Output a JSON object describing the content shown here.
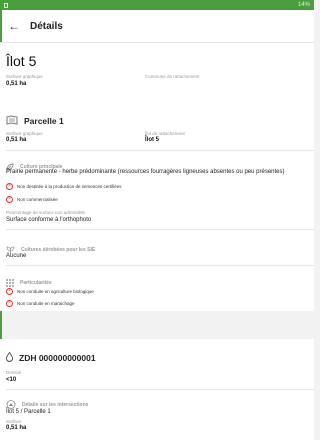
{
  "status": {
    "right": "14%"
  },
  "appbar": {
    "back_icon": "arrow-left-icon",
    "title": "Détails"
  },
  "ilot": {
    "title": "Îlot 5",
    "surface_label": "Surface graphique",
    "surface_value": "0,51 ha",
    "commune_label": "Commune de rattachement"
  },
  "parcelle": {
    "title": "Parcelle 1",
    "surface_label": "Surface graphique",
    "surface_value": "0,51 ha",
    "ilot_label": "Îlot de rattachement",
    "ilot_value": "Îlot 5",
    "culture_header": "Culture principale",
    "culture_value": "Prairie permanente - herbe prédominante (ressources fourragères ligneuses absentes ou peu présentes)",
    "flags": [
      "Non destinée à la production de semences certifiées",
      "Non commercialisée"
    ],
    "pct_label": "Pourcentage de surface non admissible",
    "pct_value": "Surface conforme à l'orthophoto",
    "derobees_header": "Cultures dérobées pour les SIE",
    "derobees_value": "Aucune",
    "particularites_header": "Particularités",
    "particularites": [
      "Non conduite en agriculture biologique",
      "Non conduite en maraichage"
    ]
  },
  "zdh": {
    "title": "ZDH 000000000001",
    "densite_label": "Densité",
    "densite_value": "<10",
    "intersections_header": "Détails sur les intersections",
    "intersection_value": "Îlot 5 / Parcelle 1",
    "surface_label": "Surface",
    "surface_value": "0,51 ha"
  }
}
